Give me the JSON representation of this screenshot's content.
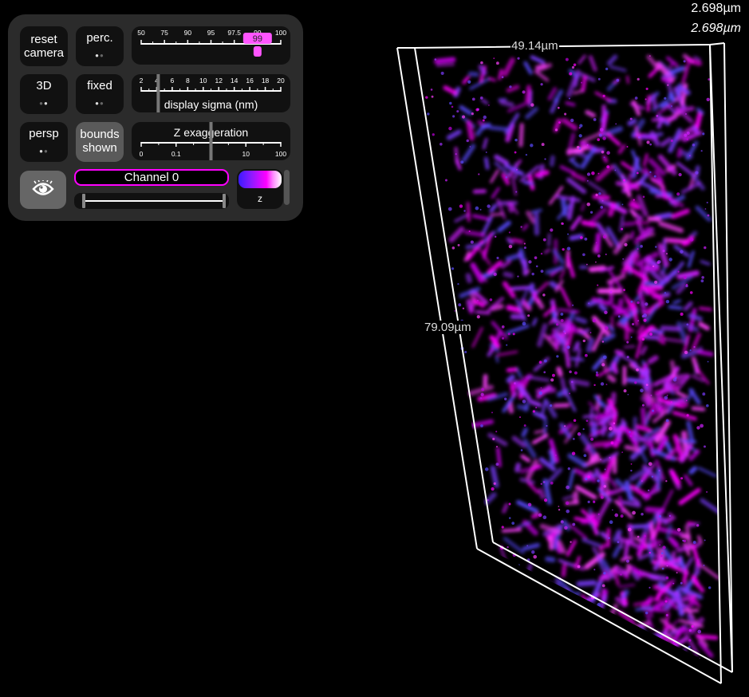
{
  "buttons": {
    "reset_camera": {
      "line1": "reset",
      "line2": "camera"
    },
    "percentile": {
      "label": "perc."
    },
    "mode_3d": {
      "label": "3D"
    },
    "fixed": {
      "label": "fixed"
    },
    "projection": {
      "label": "persp"
    },
    "bounds": {
      "line1": "bounds",
      "line2": "shown"
    }
  },
  "percentile_slider": {
    "ticks": [
      "50",
      "75",
      "90",
      "95",
      "97.5",
      "99",
      "100"
    ],
    "value": "99"
  },
  "sigma_slider": {
    "title": "display sigma (nm)",
    "ticks": [
      "2",
      "4",
      "6",
      "8",
      "10",
      "12",
      "14",
      "16",
      "18",
      "20"
    ],
    "value": 4.2
  },
  "z_slider": {
    "title": "Z exaggeration",
    "ticks": [
      "0",
      "0.1",
      "1",
      "10",
      "100"
    ],
    "value": 1
  },
  "channel": {
    "name": "Channel 0",
    "colormap_label": "z",
    "accent": "#ff00ff"
  },
  "viewer": {
    "corner_top": "2.698µm",
    "corner_bottom": "2.698µm",
    "width_label": "49.14µm",
    "height_label": "79.09µm"
  }
}
